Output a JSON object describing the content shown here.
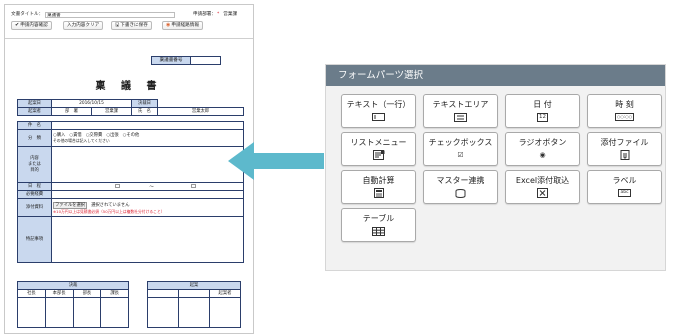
{
  "form": {
    "doc_title_label": "文書タイトル：",
    "doc_title_value": "稟議書",
    "dept_label": "申請部署：",
    "dept_req": "*",
    "dept_value": "営業課",
    "buttons": {
      "check": "申請内容確認",
      "clear": "入力内容クリア",
      "save": "下書きに保存",
      "info": "申請経路情報"
    },
    "docno_label": "稟議書番号",
    "title": "稟 議 書",
    "row1": {
      "draft_date": "起案日",
      "draft_date_val": "2016/10/15",
      "decide_date": "決裁日"
    },
    "row2": {
      "drafter": "起案者",
      "dept": "部　署",
      "dept_val": "営業課",
      "name": "氏　名",
      "name_val": "営業太郎"
    },
    "subject": "件　名",
    "category": "分　類",
    "category_options": [
      "○購入",
      "○賃借",
      "○交際費",
      "○出張",
      "○その他"
    ],
    "category_note": "その他の場合は記入してください",
    "content": "内容\nまたは\n目的",
    "schedule": "日　程",
    "schedule_sep": "～",
    "cost": "必要経費",
    "attachment": "添付資料",
    "file_button": "ファイルを選択",
    "file_status": "選択されていません",
    "attachment_note": "※10万円以上は見積書必須（50万円以上は複数社分付けること）",
    "notes": "特記事項",
    "approval_header": "決裁",
    "approval_cols": [
      "社長",
      "本部長",
      "部長",
      "課長"
    ],
    "review_header": "起案",
    "review_cols": [
      "",
      "",
      "起案者"
    ]
  },
  "panel": {
    "title": "フォームパーツ選択",
    "parts": [
      {
        "label": "テキスト（一行）",
        "icon": "text-line-icon"
      },
      {
        "label": "テキストエリア",
        "icon": "textarea-icon"
      },
      {
        "label": "日 付",
        "icon": "calendar-icon",
        "icon_text": "12"
      },
      {
        "label": "時 刻",
        "icon": "clock-icon",
        "icon_text": "○○:○○"
      },
      {
        "label": "リストメニュー",
        "icon": "list-menu-icon"
      },
      {
        "label": "チェックボックス",
        "icon": "checkbox-icon",
        "icon_text": "☑"
      },
      {
        "label": "ラジオボタン",
        "icon": "radio-icon",
        "icon_text": "◉"
      },
      {
        "label": "添付ファイル",
        "icon": "attachment-icon"
      },
      {
        "label": "自動計算",
        "icon": "calculator-icon"
      },
      {
        "label": "マスター連携",
        "icon": "master-link-icon"
      },
      {
        "label": "Excel添付取込",
        "icon": "excel-import-icon"
      },
      {
        "label": "ラベル",
        "icon": "label-icon",
        "icon_text": "abc"
      },
      {
        "label": "テーブル",
        "icon": "table-icon"
      }
    ]
  },
  "colors": {
    "header_fill": "#c9d8ee",
    "border": "#2b3e6b",
    "panel_header": "#6b7c8a",
    "arrow": "#5db9cc"
  }
}
